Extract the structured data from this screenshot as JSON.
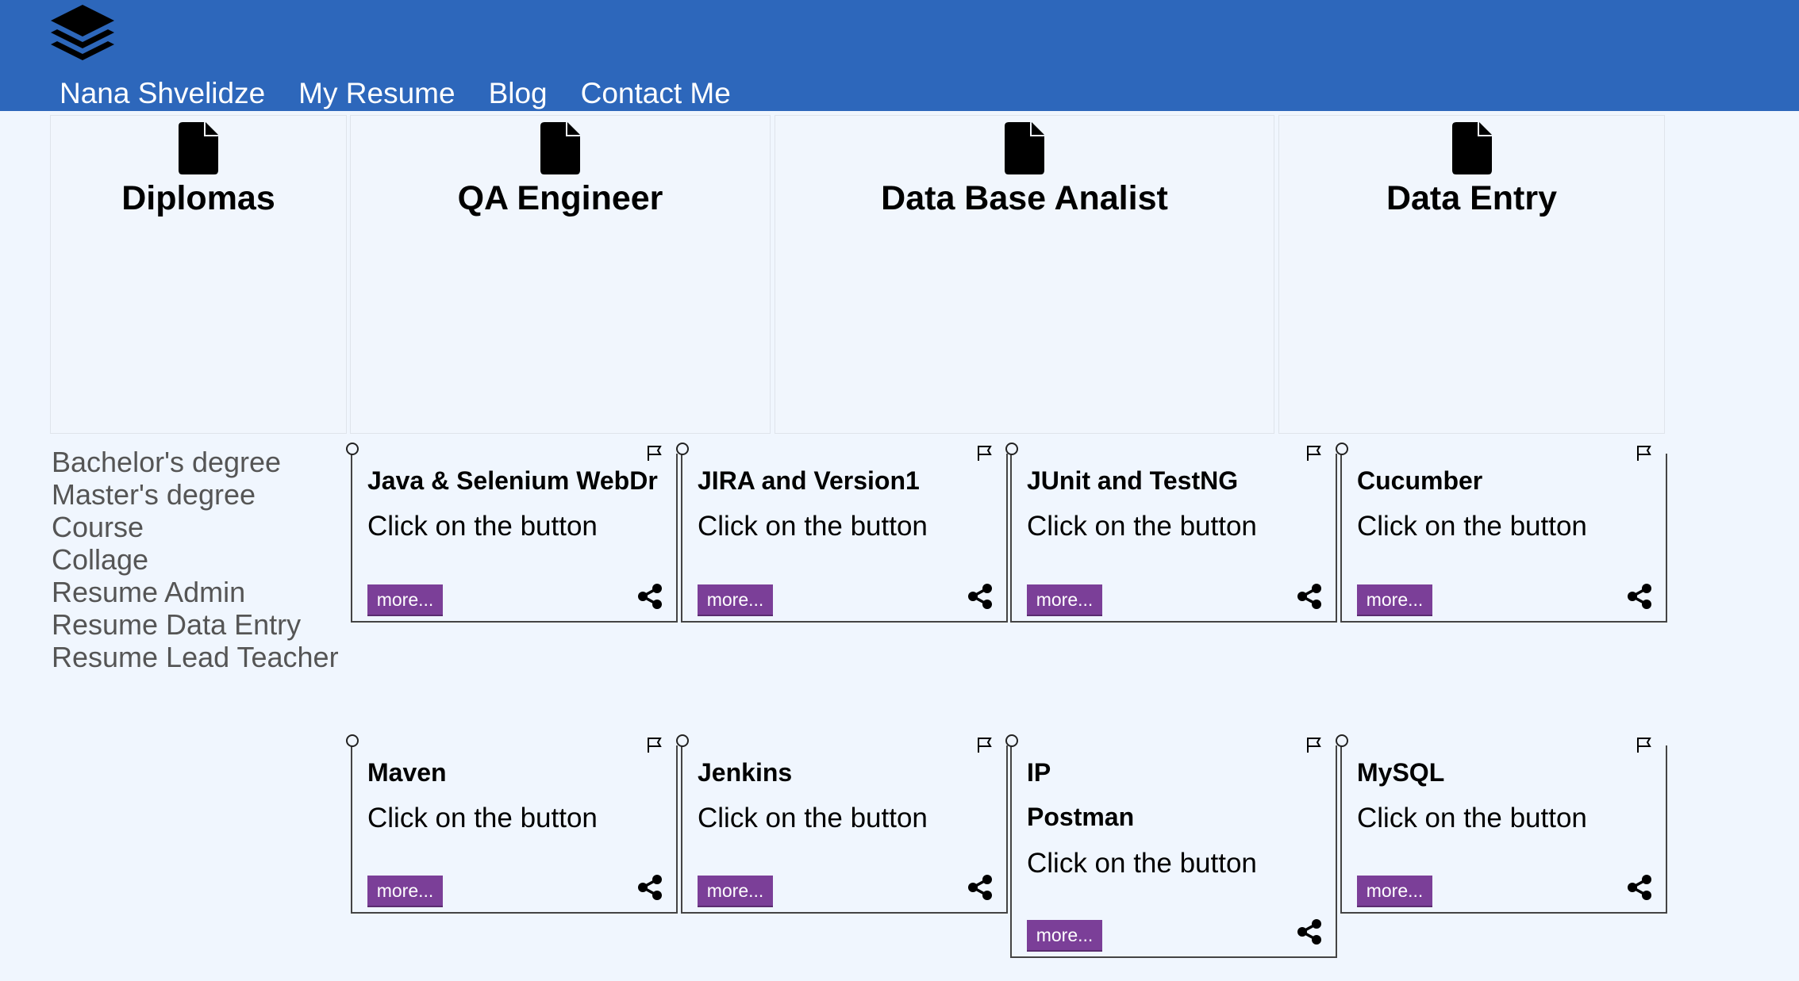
{
  "nav": {
    "items": [
      "Nana Shvelidze",
      "My Resume",
      "Blog",
      "Contact Me"
    ]
  },
  "icons": {
    "logo": "layers-icon",
    "panel": "document-icon",
    "card_marker": "radio-circle-icon",
    "card_flag": "flag-icon",
    "card_share": "share-icon"
  },
  "colors": {
    "header": "#2d67bb",
    "background": "#f0f6fe",
    "button": "#7b3f98",
    "list_text": "#555555"
  },
  "panels": [
    {
      "title": "Diplomas"
    },
    {
      "title": "QA Engineer"
    },
    {
      "title": "Data Base Analist"
    },
    {
      "title": "Data Entry"
    }
  ],
  "diplomas": [
    "Bachelor's degree",
    "Master's degree",
    "Course",
    "Collage",
    "Resume Admin",
    "Resume Data Entry",
    "Resume Lead Teacher"
  ],
  "cards": [
    {
      "title": "Java & Selenium WebDr",
      "text": "Click on the button",
      "button": "more..."
    },
    {
      "title": "JIRA and Version1",
      "text": "Click on the button",
      "button": "more..."
    },
    {
      "title": "JUnit and TestNG",
      "text": "Click on the button",
      "button": "more..."
    },
    {
      "title": "Cucumber",
      "text": "Click on the button",
      "button": "more..."
    },
    {
      "title": "Maven",
      "text": "Click on the button",
      "button": "more..."
    },
    {
      "title": "Jenkins",
      "text": "Click on the button",
      "button": "more..."
    },
    {
      "title": "IP",
      "subtitle": "Postman",
      "text": "Click on the button",
      "button": "more..."
    },
    {
      "title": "MySQL",
      "text": "Click on the button",
      "button": "more..."
    }
  ]
}
